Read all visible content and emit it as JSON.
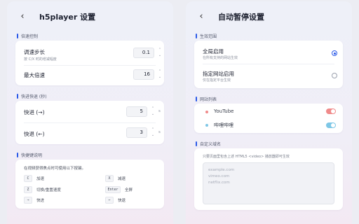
{
  "left": {
    "title": "h5player 设置",
    "speed_section": {
      "heading": "倍速控制",
      "step_label": "调速步长",
      "step_sub": "按 C/X 时的增减幅度",
      "step_value": "0.1",
      "max_label": "最大倍速",
      "max_value": "16"
    },
    "seek_section": {
      "heading": "快进快退 (秒)",
      "forward_label": "快进 (→)",
      "forward_value": "5",
      "forward_unit": "s",
      "backward_label": "快退 (←)",
      "backward_value": "3",
      "backward_unit": "s"
    },
    "shortcut_section": {
      "heading": "快捷键说明",
      "hint": "在视频获得焦点时可使用以下按键。",
      "keys": [
        {
          "key": "C",
          "desc": "加速"
        },
        {
          "key": "X",
          "desc": "减速"
        },
        {
          "key": "Z",
          "desc": "切换/重置速度"
        },
        {
          "key": "Enter",
          "desc": "全屏"
        },
        {
          "key": "→",
          "desc": "快进"
        },
        {
          "key": "←",
          "desc": "快退"
        }
      ]
    }
  },
  "right": {
    "title": "自动暂停设置",
    "scope_section": {
      "heading": "生效范围",
      "global_label": "全局启用",
      "global_sub": "在所有支持的网站生效",
      "global_selected": true,
      "specific_label": "指定网站启用",
      "specific_sub": "仅在指定平台生效",
      "specific_selected": false
    },
    "site_section": {
      "heading": "网站列表",
      "sites": [
        {
          "name": "YouTube",
          "dot_color": "#f08a8a",
          "toggle_color": "#f08a8a",
          "enabled": true
        },
        {
          "name": "哔哩哔哩",
          "dot_color": "#7ec7e6",
          "toggle_color": "#7ec7e6",
          "enabled": true
        }
      ]
    },
    "custom_section": {
      "heading": "自定义域名",
      "hint": "只要页面里包含上述 HTML5 <video> 播放器即可生效",
      "placeholder_lines": [
        "example.com",
        "vimeo.com",
        "netflix.com"
      ]
    }
  },
  "colors": {
    "accent": "#2a59e8"
  }
}
